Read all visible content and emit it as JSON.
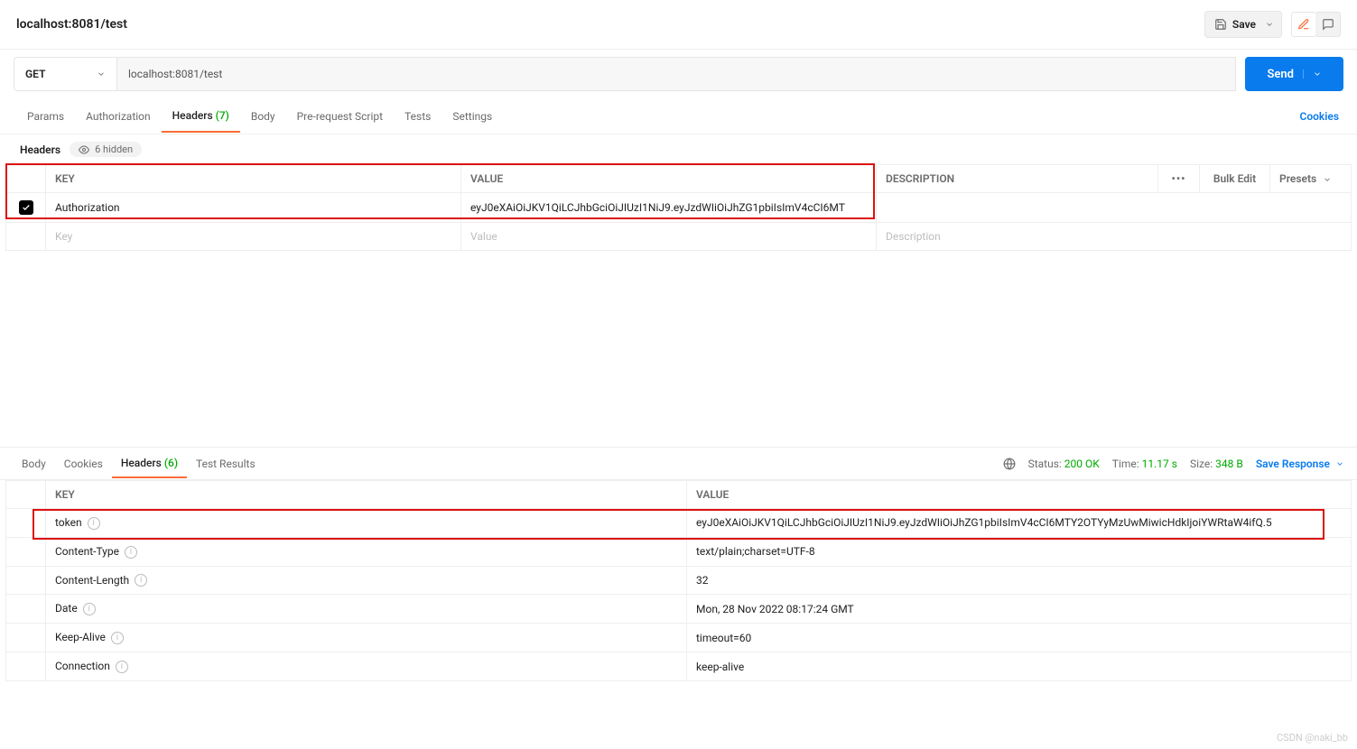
{
  "titlebar": {
    "title": "localhost:8081/test",
    "save_label": "Save"
  },
  "request": {
    "method": "GET",
    "url": "localhost:8081/test",
    "send_label": "Send",
    "tabs": {
      "params": "Params",
      "authorization": "Authorization",
      "headers": "Headers",
      "headers_count": "(7)",
      "body": "Body",
      "prerequest": "Pre-request Script",
      "tests": "Tests",
      "settings": "Settings"
    },
    "cookies_link": "Cookies",
    "headers_label": "Headers",
    "hidden_label": "6 hidden",
    "table": {
      "col_key": "KEY",
      "col_value": "VALUE",
      "col_description": "DESCRIPTION",
      "bulk_edit": "Bulk Edit",
      "presets": "Presets",
      "rows": [
        {
          "enabled": true,
          "key": "Authorization",
          "value": "eyJ0eXAiOiJKV1QiLCJhbGciOiJIUzI1NiJ9.eyJzdWIiOiJhZG1pbiIsImV4cCI6MT"
        }
      ],
      "placeholder_key": "Key",
      "placeholder_value": "Value",
      "placeholder_desc": "Description"
    }
  },
  "response": {
    "tabs": {
      "body": "Body",
      "cookies": "Cookies",
      "headers": "Headers",
      "headers_count": "(6)",
      "test_results": "Test Results"
    },
    "status_label": "Status:",
    "status_value": "200 OK",
    "time_label": "Time:",
    "time_value": "11.17 s",
    "size_label": "Size:",
    "size_value": "348 B",
    "save_response": "Save Response",
    "table": {
      "col_key": "KEY",
      "col_value": "VALUE",
      "rows": [
        {
          "key": "token",
          "value": "eyJ0eXAiOiJKV1QiLCJhbGciOiJIUzI1NiJ9.eyJzdWIiOiJhZG1pbiIsImV4cCI6MTY2OTYyMzUwMiwicHdkIjoiYWRtaW4ifQ.5"
        },
        {
          "key": "Content-Type",
          "value": "text/plain;charset=UTF-8"
        },
        {
          "key": "Content-Length",
          "value": "32"
        },
        {
          "key": "Date",
          "value": "Mon, 28 Nov 2022 08:17:24 GMT"
        },
        {
          "key": "Keep-Alive",
          "value": "timeout=60"
        },
        {
          "key": "Connection",
          "value": "keep-alive"
        }
      ]
    }
  },
  "watermark": "CSDN @naki_bb"
}
